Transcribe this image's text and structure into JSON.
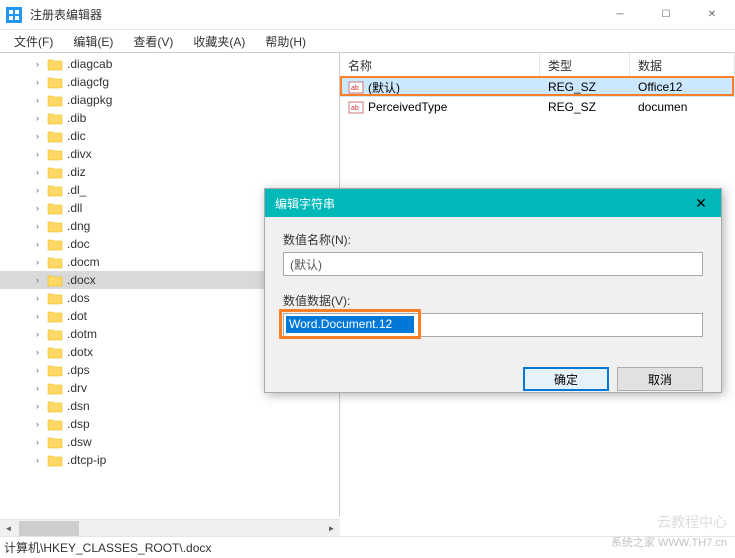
{
  "window": {
    "title": "注册表编辑器"
  },
  "menu": {
    "file": "文件(F)",
    "edit": "编辑(E)",
    "view": "查看(V)",
    "favorites": "收藏夹(A)",
    "help": "帮助(H)"
  },
  "tree": {
    "items": [
      ".diagcab",
      ".diagcfg",
      ".diagpkg",
      ".dib",
      ".dic",
      ".divx",
      ".diz",
      ".dl_",
      ".dll",
      ".dng",
      ".doc",
      ".docm",
      ".docx",
      ".dos",
      ".dot",
      ".dotm",
      ".dotx",
      ".dps",
      ".drv",
      ".dsn",
      ".dsp",
      ".dsw",
      ".dtcp-ip"
    ],
    "selected_index": 12
  },
  "list": {
    "headers": {
      "name": "名称",
      "type": "类型",
      "data": "数据"
    },
    "rows": [
      {
        "name": "(默认)",
        "type": "REG_SZ",
        "data": "Office12",
        "highlight": true
      },
      {
        "name": "PerceivedType",
        "type": "REG_SZ",
        "data": "documen",
        "highlight": false
      }
    ]
  },
  "dialog": {
    "title": "编辑字符串",
    "name_label": "数值名称(N):",
    "name_value": "(默认)",
    "data_label": "数值数据(V):",
    "data_value": "Word.Document.12",
    "ok": "确定",
    "cancel": "取消"
  },
  "statusbar": {
    "path": "计算机\\HKEY_CLASSES_ROOT\\.docx"
  },
  "watermark": {
    "main": "云教程中心",
    "sub": "系统之家 WWW.TH7.cn"
  }
}
